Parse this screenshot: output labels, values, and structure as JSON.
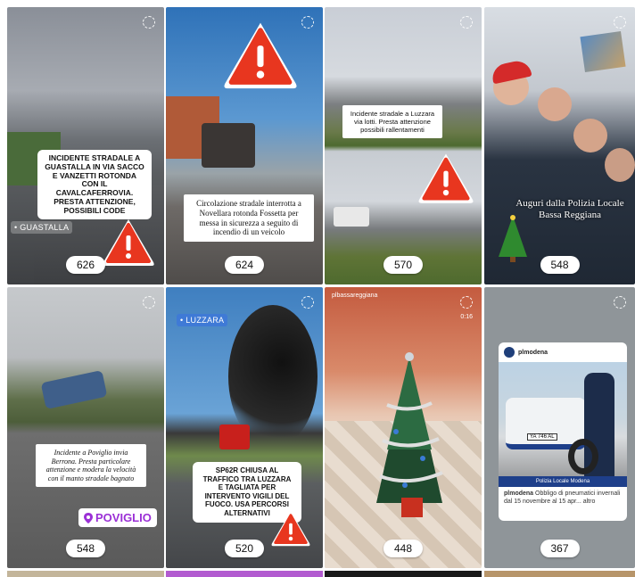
{
  "tiles": [
    {
      "id": "t1",
      "count": "626",
      "caption": "INCIDENTE STRADALE  A GUASTALLA IN VIA SACCO E VANZETTI ROTONDA CON IL CAVALCAFERROVIA. PRESTA ATTENZIONE, POSSIBILI CODE",
      "location": "• GUASTALLA"
    },
    {
      "id": "t2",
      "count": "624",
      "caption": "Circolazione stradale interrotta a Novellara rotonda Fossetta per messa in sicurezza a seguito di incendio di un veicolo"
    },
    {
      "id": "t3",
      "count": "570",
      "caption": "Incidente stradale a Luzzara via lotti. Presta attenzione possibili rallentamenti"
    },
    {
      "id": "t4",
      "count": "548",
      "caption": "Auguri dalla Polizia Locale Bassa Reggiana"
    },
    {
      "id": "t5",
      "count": "548",
      "caption": "Incidente a Poviglio inviа Berrona. Presta particolare attenzione e modera la velocità con il manto stradale bagnato",
      "location": "POVIGLIO"
    },
    {
      "id": "t6",
      "count": "520",
      "caption": "SP62R CHIUSA AL TRAFFICO TRA LUZZARA E TAGLIATA PER INTERVENTO VIGILI DEL FUOCO. USA PERCORSI ALTERNATIVI",
      "location": "• LUZZARA"
    },
    {
      "id": "t7",
      "count": "448",
      "account": "plbassareggiana",
      "time": "0:16"
    },
    {
      "id": "t8",
      "count": "367",
      "account": "plmodena",
      "post_label": "Polizia Locale Modena",
      "post_caption_user": "plmodena",
      "post_caption": "Obbligo di pneumatici invernali dal 15 novembre al 15 apr... altro",
      "plate": "YA 746 AL"
    }
  ],
  "colors": {
    "warn": "#e8361f",
    "white": "#ffffff"
  }
}
